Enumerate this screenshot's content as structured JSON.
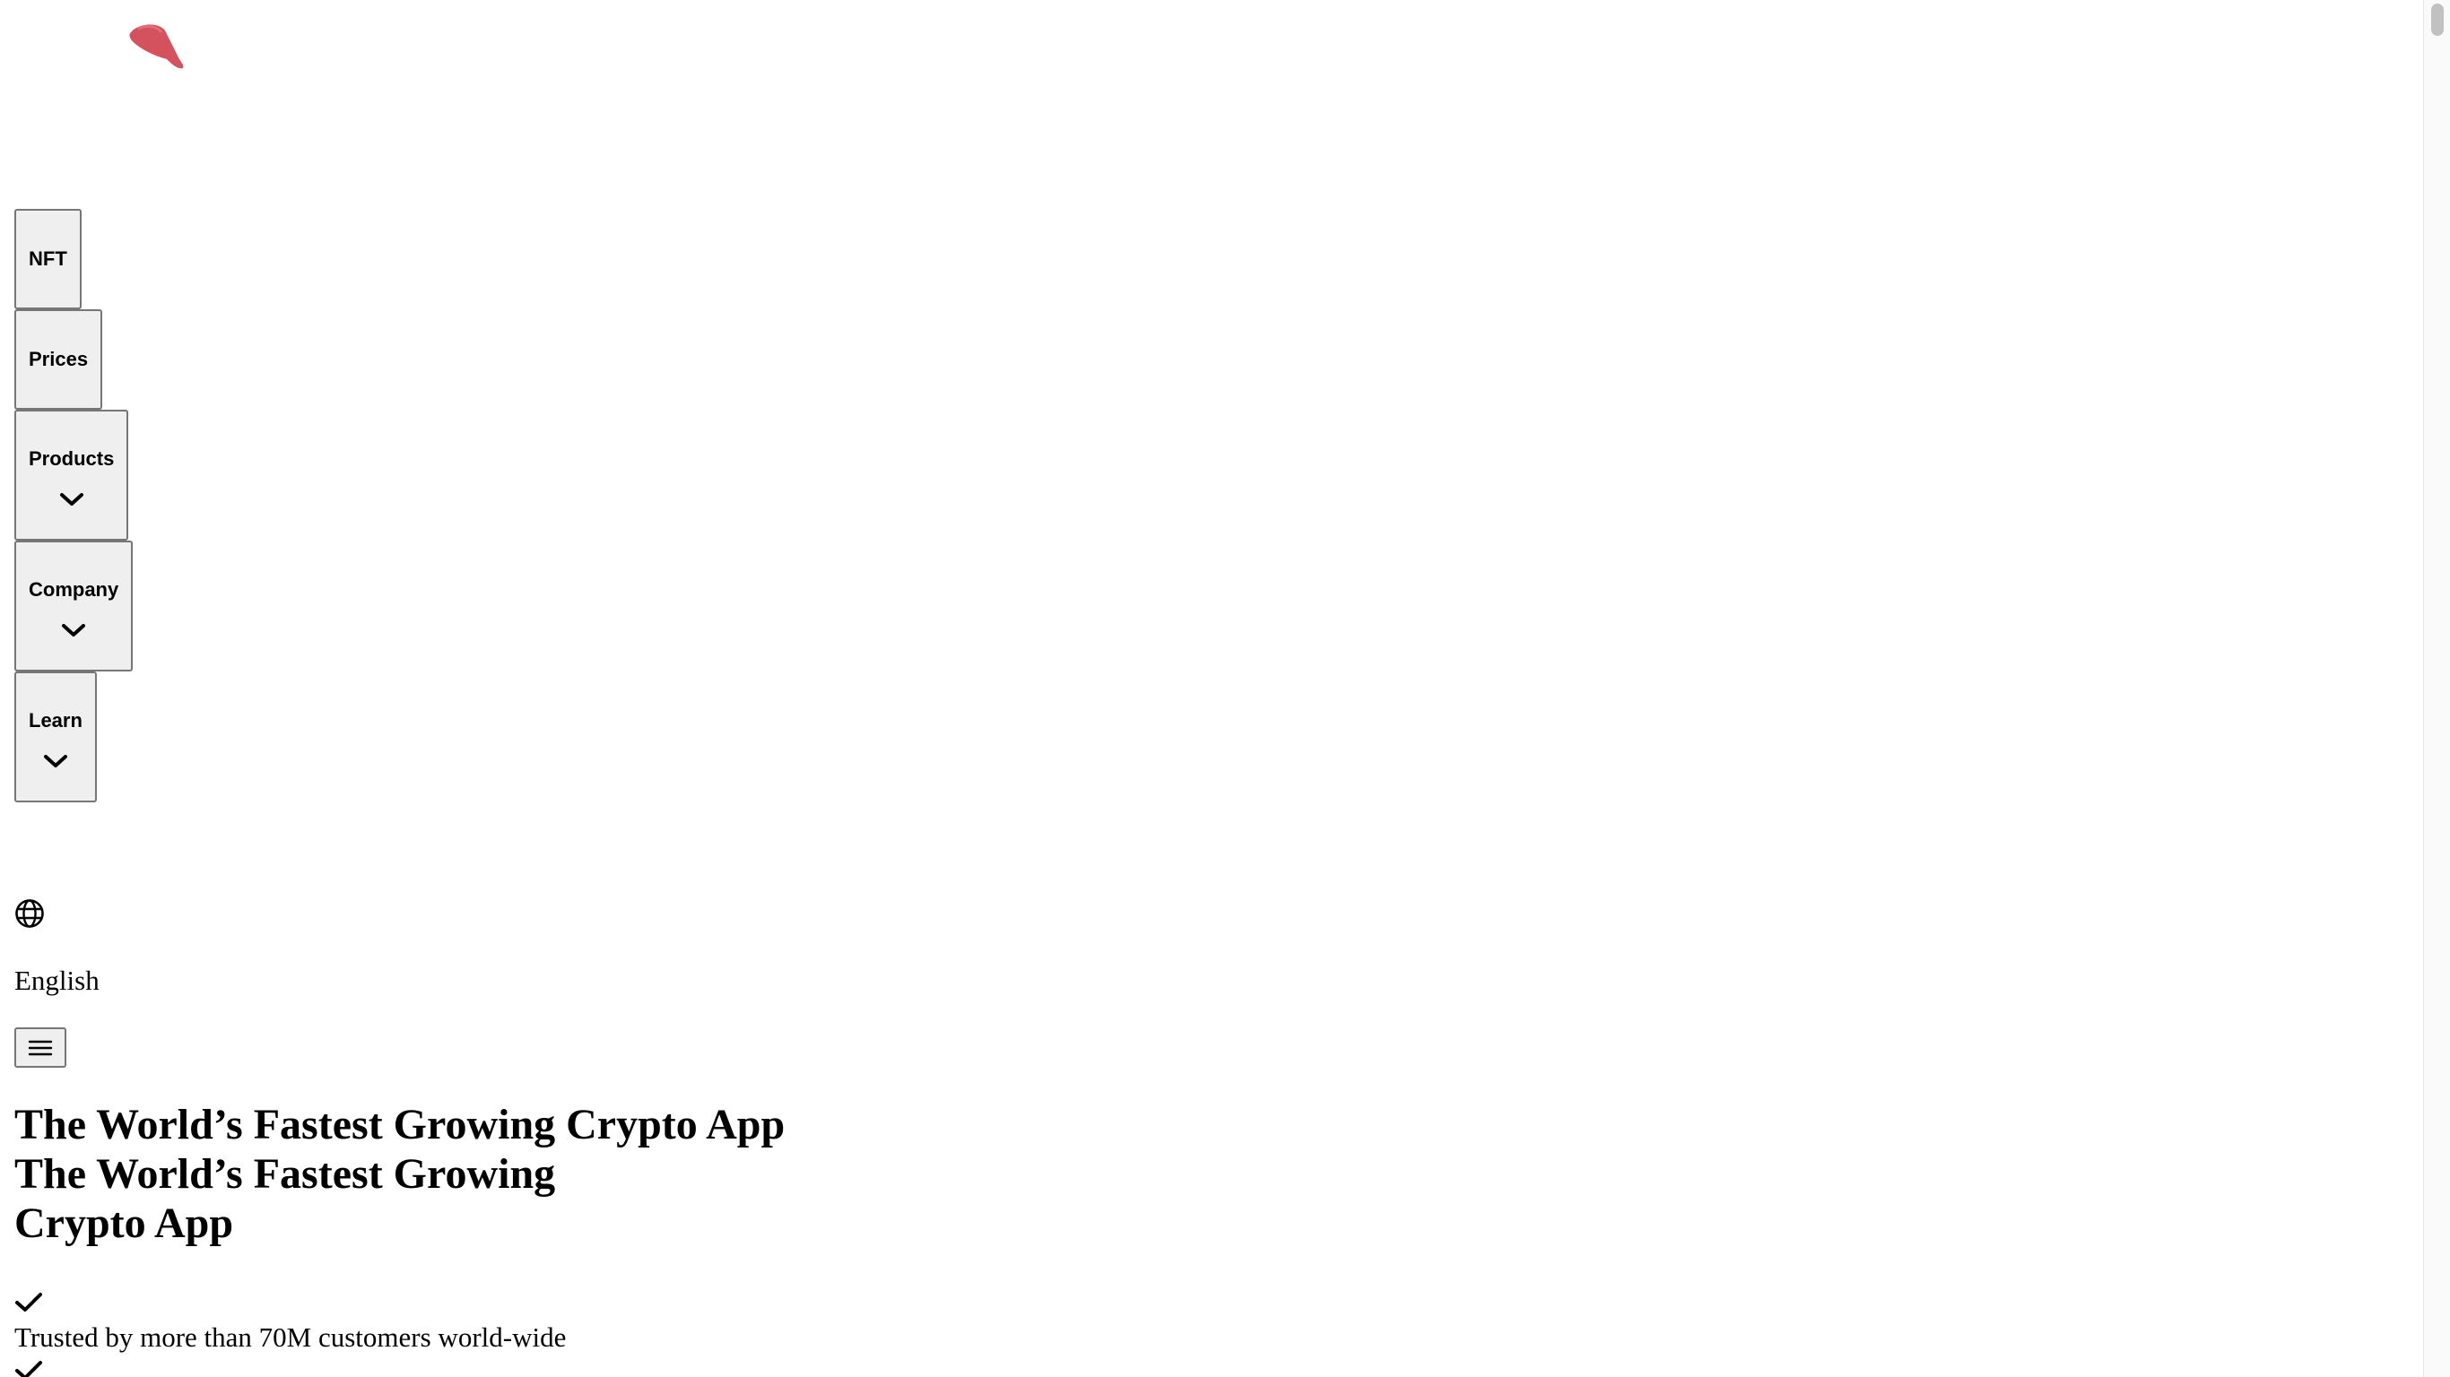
{
  "header": {
    "logo_icon": "red-gem-logo",
    "brand_color": "#d0434f"
  },
  "nav": {
    "items": [
      {
        "label": "NFT",
        "has_dropdown": false
      },
      {
        "label": "Prices",
        "has_dropdown": false
      },
      {
        "label": "Products",
        "has_dropdown": true
      },
      {
        "label": "Company",
        "has_dropdown": true
      },
      {
        "label": "Learn",
        "has_dropdown": true
      }
    ],
    "dropdown_icon": "chevron-down-icon"
  },
  "language": {
    "icon": "globe-icon",
    "label": "English"
  },
  "menu": {
    "icon": "hamburger-menu-icon"
  },
  "hero": {
    "title_a": "The World’s Fastest Growing Crypto App",
    "title_b_line1": "The World’s Fastest Growing",
    "title_b_line2": "Crypto App",
    "check_icon": "checkmark-icon",
    "features": [
      "Trusted by more than 70M customers world-wide"
    ]
  }
}
